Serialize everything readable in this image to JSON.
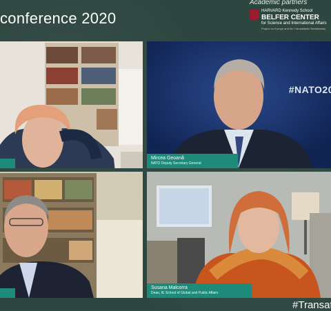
{
  "header": {
    "title": "conference 2020",
    "partners_label": "Academic partners"
  },
  "partner_logo": {
    "institution": "HARVARD Kennedy School",
    "name": "BELFER CENTER",
    "subtitle": "for Science and International Affairs",
    "tagline": "Project on Europe and the Transatlantic Relationship"
  },
  "speakers": [
    {
      "name": "",
      "role": ""
    },
    {
      "name": "Mircea Geoană",
      "role": "NATO Deputy Secretary General",
      "hashtag": "#NATO20"
    },
    {
      "name": "",
      "role": ""
    },
    {
      "name": "Susana Malcorra",
      "role": "Dean, IE School of Global and Public Affairs"
    }
  ],
  "footer": {
    "hashtag": "#Transatl"
  },
  "colors": {
    "background": "#2d463f",
    "caption": "#1e8a79",
    "shield": "#9b1c2e"
  }
}
